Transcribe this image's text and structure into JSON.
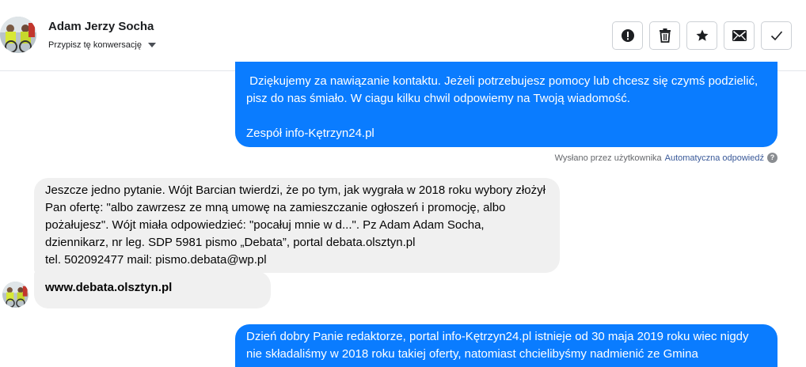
{
  "header": {
    "name": "Adam Jerzy Socha",
    "assign_label": "Przypisz tę konwersację",
    "actions": [
      {
        "name": "report",
        "icon": "alert-circle-icon"
      },
      {
        "name": "delete",
        "icon": "trash-icon"
      },
      {
        "name": "star",
        "icon": "star-icon"
      },
      {
        "name": "mark-unread",
        "icon": "envelope-icon"
      },
      {
        "name": "done",
        "icon": "check-icon"
      }
    ]
  },
  "messages": {
    "m1": " Dziękujemy za nawiązanie kontaktu. Jeżeli potrzebujesz pomocy lub chcesz się czymś podzielić, pisz do nas śmiało. W ciagu kilku chwil odpowiemy na Twoją wiadomość.\n\nZespół info-Kętrzyn24.pl",
    "m1_note_prefix": "Wysłano przez użytkownika",
    "m1_note_user": "Automatyczna odpowiedź",
    "m1_note_help": "?",
    "m3": "Jeszcze jedno pytanie. Wójt Barcian twierdzi, że po tym, jak wygrała w 2018 roku wybory złożył Pan ofertę: \"albo zawrzesz ze mną umowę na zamieszczanie ogłoszeń i promocję, albo pożałujesz\". Wójt miała odpowiedzieć: \"pocałuj mnie w d...\". Pz Adam Adam Socha, dziennikarz, nr leg. SDP 5981 pismo „Debata”, portal debata.olsztyn.pl\ntel. 502092477 mail: pismo.debata@wp.pl",
    "m4": "www.debata.olsztyn.pl",
    "m5": "Dzień dobry Panie redaktorze, portal info-Kętrzyn24.pl istnieje od 30 maja 2019 roku wiec nigdy nie składaliśmy w 2018 roku takiej oferty, natomiast chcielibyśmy nadmienić ze Gmina"
  },
  "colors": {
    "outgoing_bubble": "#0a7cff",
    "incoming_bubble": "#f0f0f0",
    "link_blue": "#385898"
  }
}
